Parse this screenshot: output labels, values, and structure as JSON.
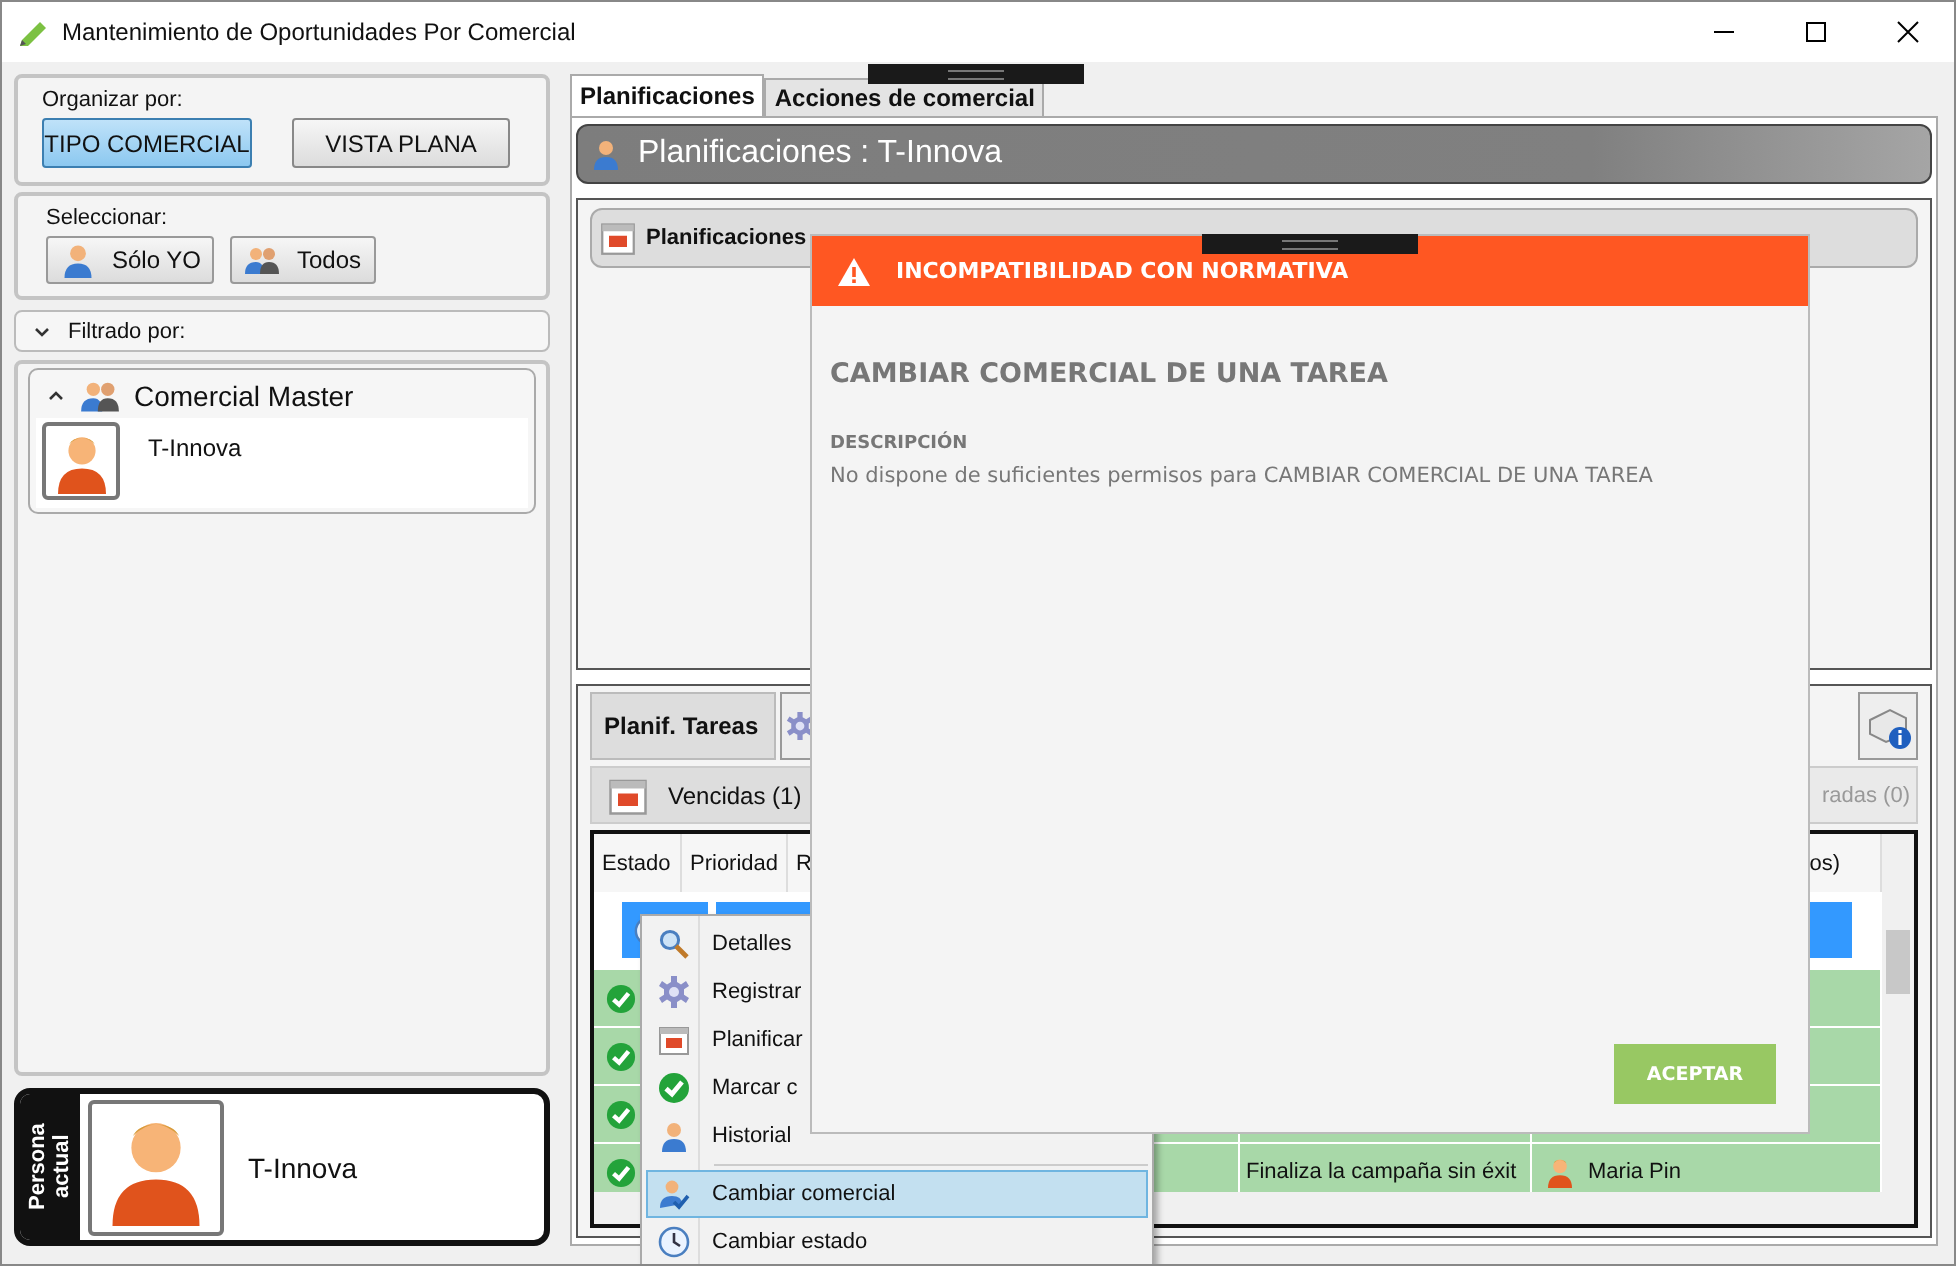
{
  "window": {
    "title": "Mantenimiento de Oportunidades Por Comercial"
  },
  "organize": {
    "label": "Organizar por:",
    "options": [
      {
        "label": "TIPO COMERCIAL",
        "selected": true
      },
      {
        "label": "VISTA PLANA",
        "selected": false
      }
    ]
  },
  "select": {
    "label": "Seleccionar:",
    "buttons": [
      {
        "label": "Sólo YO",
        "kind": "single"
      },
      {
        "label": "Todos",
        "kind": "group"
      }
    ]
  },
  "filter": {
    "label": "Filtrado por:",
    "expanded": false
  },
  "groups": [
    {
      "name": "Comercial Master",
      "expanded": true,
      "members": [
        "T-Innova"
      ]
    }
  ],
  "current_person": {
    "label": "Persona actual",
    "name": "T-Innova"
  },
  "tabs": [
    {
      "label": "Planificaciones",
      "selected": true
    },
    {
      "label": "Acciones de comercial",
      "selected": false
    }
  ],
  "header": {
    "title": "Planificaciones : T-Innova"
  },
  "planning_panel": {
    "title": "Planificaciones"
  },
  "tasks": {
    "title": "Planif. Tareas",
    "filters": [
      {
        "label": "Vencidas (1)",
        "disabled": false
      },
      {
        "label": "radas (0)",
        "disabled": true
      }
    ]
  },
  "table": {
    "columns": [
      {
        "label": "Estado"
      },
      {
        "label": "Prioridad"
      },
      {
        "label": "R"
      },
      {
        "label": "os)"
      }
    ],
    "rows": [
      {
        "kind": "pending",
        "selected": true
      },
      {
        "kind": "done",
        "selected": false
      },
      {
        "kind": "done",
        "selected": false
      },
      {
        "kind": "done",
        "selected": false
      },
      {
        "kind": "done",
        "selected": false,
        "description": "Finaliza la campaña sin éxit",
        "person": "Maria Pin"
      }
    ]
  },
  "context_menu": {
    "items": [
      {
        "label": "Detalles",
        "selected": false
      },
      {
        "label": "Registrar",
        "selected": false
      },
      {
        "label": "Planificar",
        "selected": false
      },
      {
        "label": "Marcar c",
        "selected": false
      },
      {
        "label": "Historial",
        "selected": false
      },
      {
        "label": "Cambiar comercial",
        "selected": true
      },
      {
        "label": "Cambiar estado",
        "selected": false
      }
    ]
  },
  "dialog": {
    "title": "INCOMPATIBILIDAD CON NORMATIVA",
    "heading": "CAMBIAR COMERCIAL DE UNA TAREA",
    "description_label": "DESCRIPCIÓN",
    "description": "No dispone de suficientes permisos para CAMBIAR COMERCIAL DE UNA TAREA",
    "button": "ACEPTAR"
  }
}
